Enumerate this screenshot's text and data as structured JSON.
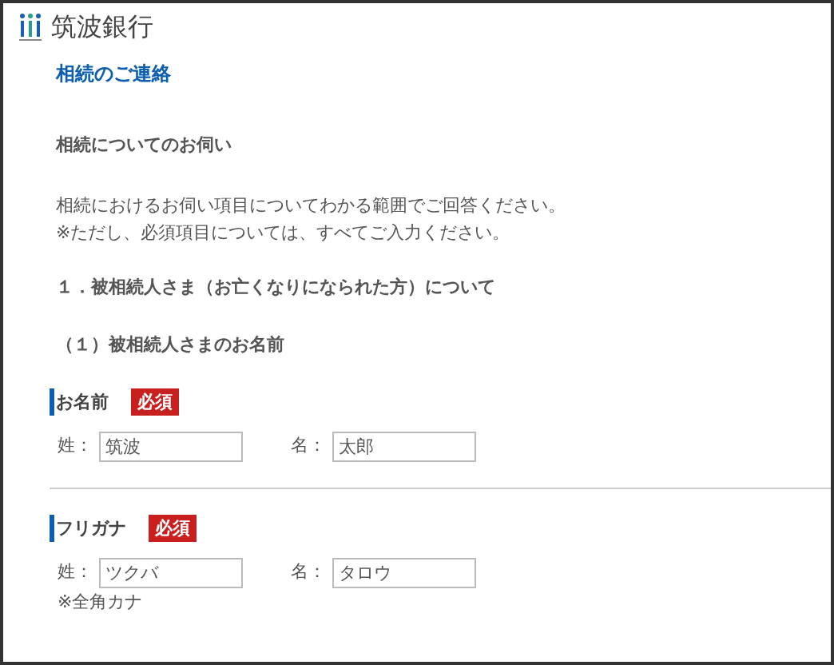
{
  "header": {
    "bank_name": "筑波銀行"
  },
  "page_title": "相続のご連絡",
  "section_title": "相続についてのお伺い",
  "intro": [
    "相続におけるお伺い項目についてわかる範囲でご回答ください。",
    "※ただし、必須項目については、すべてご入力ください。"
  ],
  "heading": "１．被相続人さま（お亡くなりになられた方）について",
  "subheading": "（１）被相続人さまのお名前",
  "fields": [
    {
      "label": "お名前",
      "required": true,
      "badge": "必須",
      "inputs": [
        {
          "label": "姓：",
          "value": "筑波"
        },
        {
          "label": "名：",
          "value": "太郎"
        }
      ]
    },
    {
      "label": "フリガナ",
      "required": true,
      "badge": "必須",
      "inputs": [
        {
          "label": "姓：",
          "value": "ツクバ"
        },
        {
          "label": "名：",
          "value": "タロウ"
        }
      ],
      "note": "※全角カナ"
    }
  ]
}
